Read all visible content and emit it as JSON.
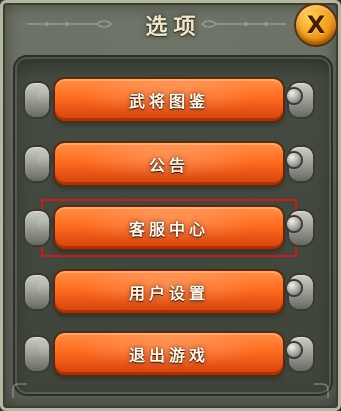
{
  "dialog": {
    "title": "选项",
    "close_label": "X"
  },
  "menu": {
    "items": [
      {
        "label": "武将图鉴"
      },
      {
        "label": "公告"
      },
      {
        "label": "客服中心"
      },
      {
        "label": "用户设置"
      },
      {
        "label": "退出游戏"
      }
    ],
    "selected_index": 2
  },
  "colors": {
    "selection_outline": "#c91d1d",
    "button_top": "#ff8e45",
    "button_bottom": "#d43f0b",
    "title_text": "#f1e6c8"
  },
  "icons": {
    "close": "close-icon",
    "ornament": "ornament-icon",
    "rivet": "rivet-icon",
    "end_cap": "end-cap-icon"
  }
}
